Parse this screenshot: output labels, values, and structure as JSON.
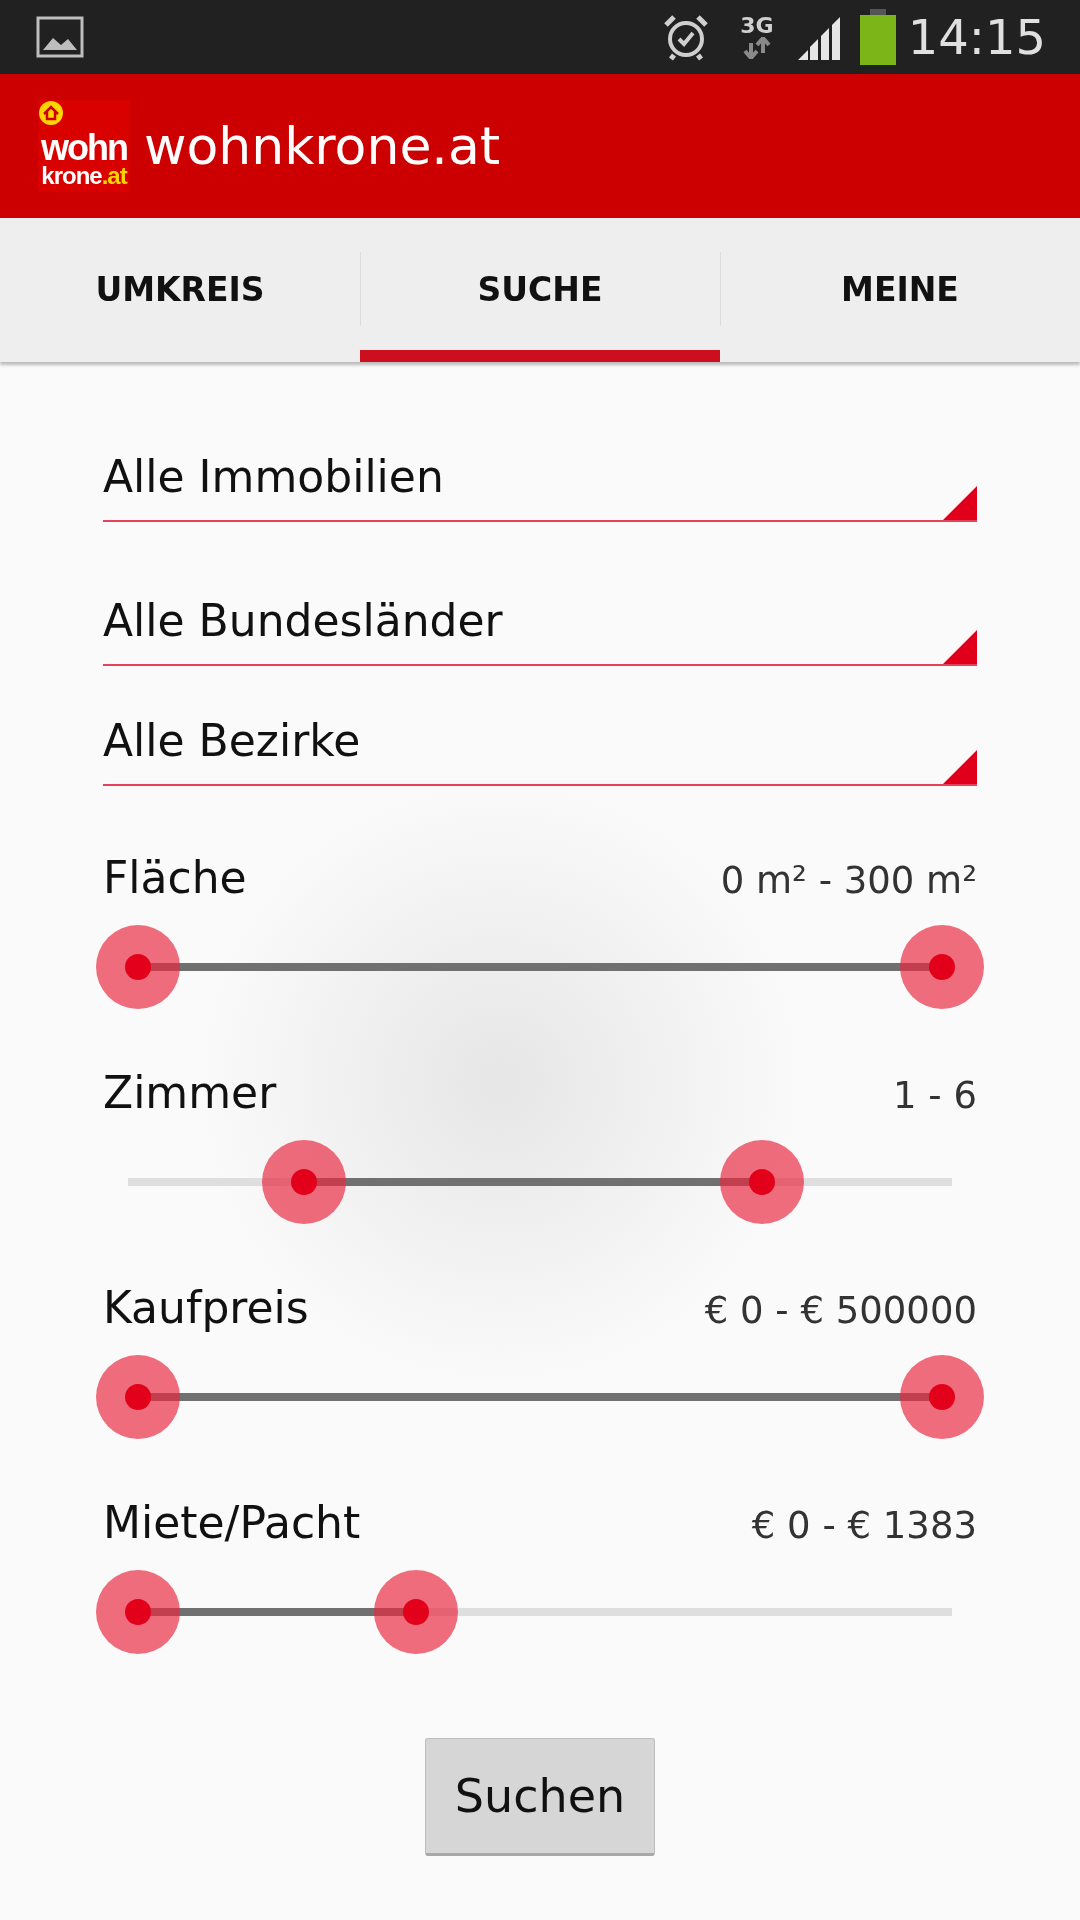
{
  "status_bar": {
    "network": "3G",
    "time": "14:15"
  },
  "app_bar": {
    "logo": {
      "top": "wohn",
      "bottom": "krone",
      "suffix": ".at"
    },
    "title": "wohnkrone.at"
  },
  "tabs": [
    {
      "label": "UMKREIS",
      "selected": false
    },
    {
      "label": "SUCHE",
      "selected": true
    },
    {
      "label": "MEINE",
      "selected": false
    }
  ],
  "spinners": [
    {
      "value": "Alle Immobilien"
    },
    {
      "value": "Alle Bundesländer"
    },
    {
      "value": "Alle Bezirke"
    }
  ],
  "sliders": [
    {
      "label": "Fläche",
      "reading": "0 m² - 300 m²",
      "handles": [
        {
          "level": 0
        },
        {
          "level": 1
        }
      ]
    },
    {
      "label": "Zimmer",
      "reading": "1 - 6",
      "handles": [
        {
          "level": 0.206
        },
        {
          "level": 0.776
        }
      ]
    },
    {
      "label": "Kaufpreis",
      "reading": "€ 0 - € 500000",
      "handles": [
        {
          "level": 0
        },
        {
          "level": 1
        }
      ]
    },
    {
      "label": "Miete/Pacht",
      "reading": "€ 0 - € 1383",
      "handles": [
        {
          "level": 0
        },
        {
          "level": 0.346
        }
      ]
    }
  ],
  "button": {
    "label": "Suchen"
  }
}
